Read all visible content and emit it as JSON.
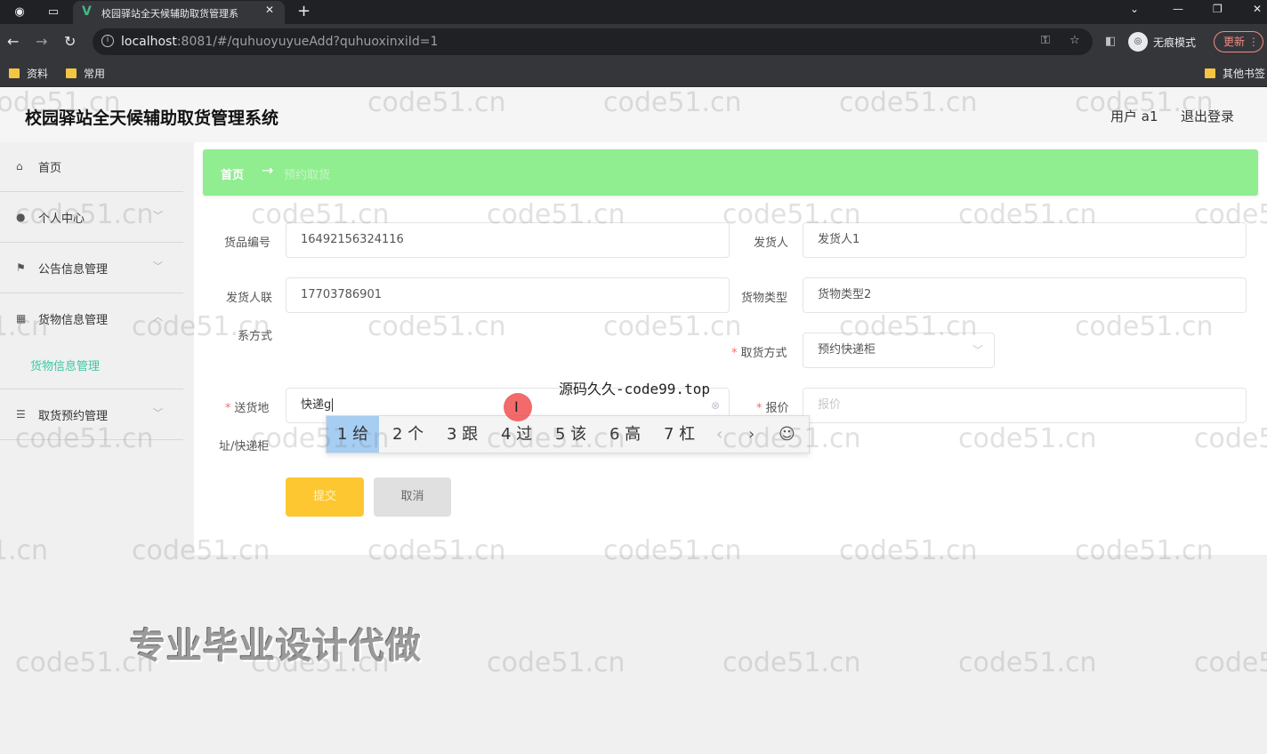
{
  "browser": {
    "tab_title": "校园驿站全天候辅助取货管理系",
    "url_host": "localhost",
    "url_rest": ":8081/#/quhuoyuyueAdd?quhuoxinxiId=1",
    "profile_label": "无痕模式",
    "update_label": "更新",
    "bookmarks": [
      "资料",
      "常用"
    ],
    "other_bookmarks": "其他书签"
  },
  "app": {
    "title": "校园驿站全天候辅助取货管理系统",
    "user": "用户 a1",
    "logout": "退出登录"
  },
  "sidebar": {
    "items": [
      {
        "label": "首页",
        "icon": "home-icon"
      },
      {
        "label": "个人中心",
        "icon": "user-icon"
      },
      {
        "label": "公告信息管理",
        "icon": "flag-icon"
      },
      {
        "label": "货物信息管理",
        "icon": "grid-icon"
      },
      {
        "label": "取货预约管理",
        "icon": "list-icon"
      }
    ],
    "submenu": "货物信息管理"
  },
  "breadcrumb": {
    "home": "首页",
    "arrow": "→",
    "current": "预约取货"
  },
  "form": {
    "goods_no_label": "货品编号",
    "goods_no_value": "16492156324116",
    "sender_label": "发货人",
    "sender_value": "发货人1",
    "sender_phone_label_1": "发货人联",
    "sender_phone_label_2": "系方式",
    "sender_phone_value": "17703786901",
    "goods_type_label": "货物类型",
    "goods_type_value": "货物类型2",
    "pickup_method_label": "取货方式",
    "pickup_method_value": "预约快递柜",
    "address_label_1": "送货地",
    "address_label_2": "址/快递柜",
    "address_value": "快递g",
    "price_label": "报价",
    "price_placeholder": "报价",
    "submit": "提交",
    "cancel": "取消"
  },
  "ime": {
    "candidates": [
      "1 给",
      "2 个",
      "3 跟",
      "4 过",
      "5 该",
      "6 高",
      "7 杠"
    ],
    "prev": "‹",
    "next": "›",
    "emoji": "☺"
  },
  "overlay_text": "源码久久-code99.top",
  "ad_text": "专业毕业设计代做",
  "watermark_text": "code51.cn"
}
